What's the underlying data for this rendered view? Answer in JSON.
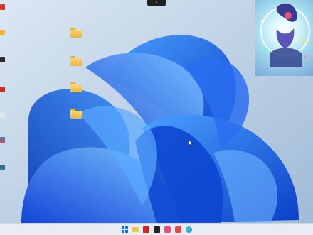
{
  "desktop": {
    "wallpaper": "windows-11-bloom",
    "folders": [
      {
        "label": ""
      },
      {
        "label": ""
      },
      {
        "label": ""
      },
      {
        "label": ""
      }
    ],
    "left_icons": [
      {
        "icon": "app-icon-red",
        "color": "#d9332b"
      },
      {
        "icon": "file-icon",
        "color": "#f0b431"
      },
      {
        "icon": "app-icon-dark",
        "color": "#2b2b2b"
      },
      {
        "icon": "app-icon-red",
        "color": "#c52c2c"
      },
      {
        "icon": "file-icon",
        "color": "#e0e6ee"
      },
      {
        "icon": "app-icon-multicolor",
        "color": "#3a7bd5"
      },
      {
        "icon": "app-icon-multicolor",
        "color": "#2d6a3e"
      }
    ]
  },
  "top_tab": {
    "label": "⌄"
  },
  "widget": {
    "image": "anime-character-widget"
  },
  "taskbar": {
    "items": [
      {
        "name": "start-button",
        "icon": "windows-logo-icon",
        "color": "#1a73e8"
      },
      {
        "name": "taskbar-file-explorer",
        "icon": "folder-icon",
        "color": "#f2c14e"
      },
      {
        "name": "taskbar-app-red",
        "icon": "app-icon",
        "color": "#c62828"
      },
      {
        "name": "taskbar-app-dark",
        "icon": "app-icon",
        "color": "#222222"
      },
      {
        "name": "taskbar-app-pink",
        "icon": "app-icon",
        "color": "#e94d7a"
      },
      {
        "name": "taskbar-app-red2",
        "icon": "app-icon",
        "color": "#e24a4a"
      },
      {
        "name": "taskbar-edge",
        "icon": "edge-icon",
        "color": "#1aa7a0"
      }
    ]
  }
}
